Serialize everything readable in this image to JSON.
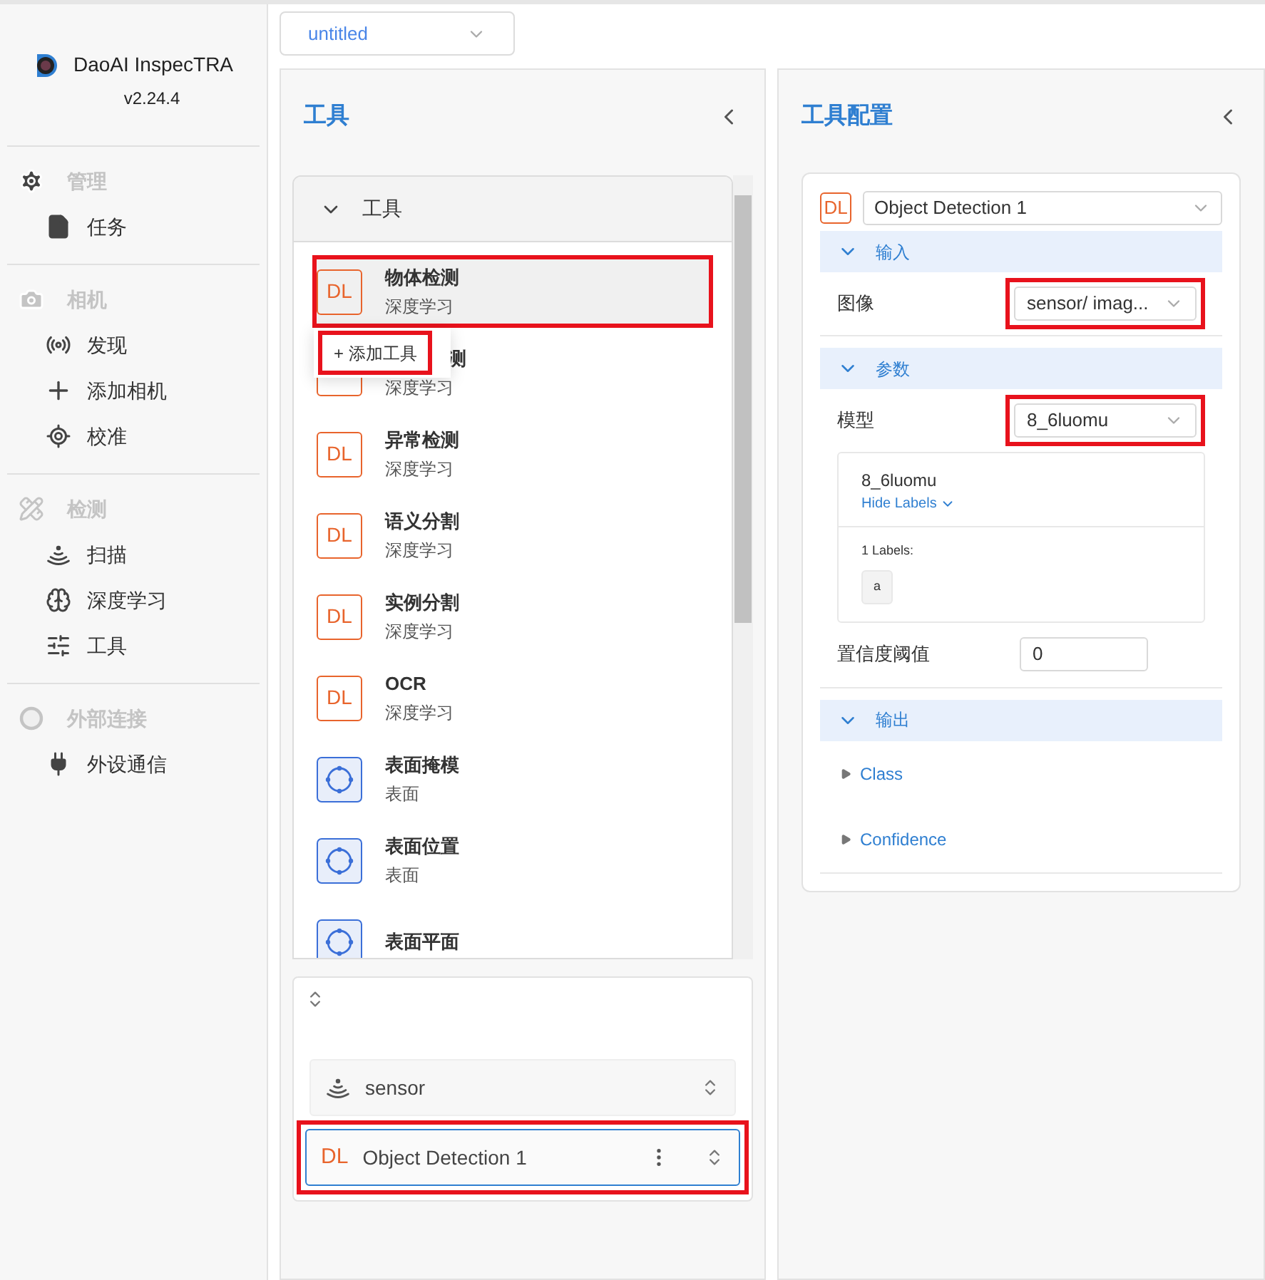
{
  "sidebar": {
    "app_name": "DaoAI InspecTRA",
    "version": "v2.24.4",
    "sections": [
      {
        "title": "管理",
        "items": [
          {
            "label": "任务"
          }
        ]
      },
      {
        "title": "相机",
        "items": [
          {
            "label": "发现"
          },
          {
            "label": "添加相机"
          },
          {
            "label": "校准"
          }
        ]
      },
      {
        "title": "检测",
        "items": [
          {
            "label": "扫描"
          },
          {
            "label": "深度学习"
          },
          {
            "label": "工具"
          }
        ]
      },
      {
        "title": "外部连接",
        "items": [
          {
            "label": "外设通信"
          }
        ]
      }
    ]
  },
  "project_select": {
    "value": "untitled"
  },
  "tools_panel": {
    "title": "工具",
    "group": {
      "title": "工具",
      "expanded": true,
      "items": [
        {
          "kind": "dl",
          "badge": "DL",
          "name": "物体检测",
          "category": "深度学习",
          "highlighted": true
        },
        {
          "kind": "dl_covered",
          "name": "测",
          "category": "深度学习",
          "highlighted": false
        },
        {
          "kind": "dl",
          "badge": "DL",
          "name": "异常检测",
          "category": "深度学习",
          "highlighted": false
        },
        {
          "kind": "dl",
          "badge": "DL",
          "name": "语义分割",
          "category": "深度学习",
          "highlighted": false
        },
        {
          "kind": "dl",
          "badge": "DL",
          "name": "实例分割",
          "category": "深度学习",
          "highlighted": false
        },
        {
          "kind": "dl",
          "badge": "DL",
          "name": "OCR",
          "category": "深度学习",
          "highlighted": false
        },
        {
          "kind": "surface",
          "name": "表面掩模",
          "category": "表面",
          "highlighted": false
        },
        {
          "kind": "surface",
          "name": "表面位置",
          "category": "表面",
          "highlighted": false
        },
        {
          "kind": "surface",
          "name": "表面平面",
          "highlighted": false
        }
      ]
    },
    "context_menu": {
      "label": "+ 添加工具",
      "highlighted": true
    }
  },
  "pipeline": {
    "nodes": [
      {
        "kind": "sensor",
        "label": "sensor",
        "selected": false,
        "highlighted": false
      },
      {
        "kind": "dl",
        "badge": "DL",
        "label": "Object Detection 1",
        "selected": true,
        "highlighted": true
      }
    ]
  },
  "config_panel": {
    "title": "工具配置",
    "tool_badge": "DL",
    "tool_select": "Object Detection 1",
    "sections": [
      {
        "title": "输入",
        "expanded": true,
        "rows": [
          {
            "kind": "select",
            "label": "图像",
            "value": "sensor/ imag...",
            "highlighted": true
          }
        ]
      },
      {
        "title": "参数",
        "expanded": true,
        "rows": [
          {
            "kind": "select",
            "label": "模型",
            "value": "8_6luomu",
            "highlighted": true
          },
          {
            "kind": "model_card",
            "name": "8_6luomu",
            "toggle": "Hide Labels",
            "labels_title": "1 Labels:",
            "labels": [
              "a"
            ]
          },
          {
            "kind": "input",
            "label": "置信度阈值",
            "value": "0"
          }
        ]
      },
      {
        "title": "输出",
        "expanded": true,
        "rows": [
          {
            "kind": "output",
            "label": "Class"
          },
          {
            "kind": "output",
            "label": "Confidence"
          }
        ]
      }
    ]
  }
}
